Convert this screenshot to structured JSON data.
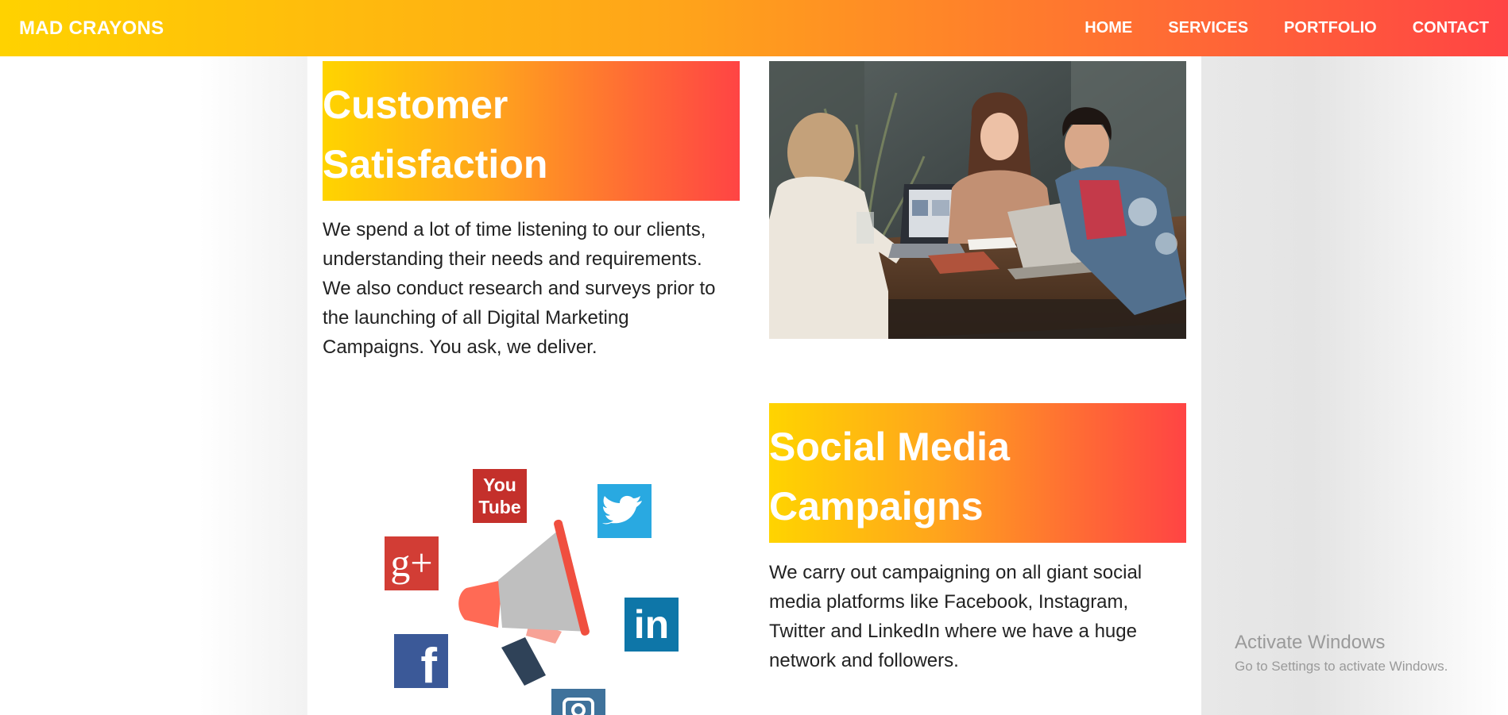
{
  "navbar": {
    "brand": "MAD CRAYONS",
    "links": [
      "HOME",
      "SERVICES",
      "PORTFOLIO",
      "CONTACT"
    ]
  },
  "sections": [
    {
      "heading_line1": "Customer",
      "heading_line2": "Satisfaction",
      "body_lines": [
        "We spend a lot of time listening to our clients,",
        "understanding their needs and requirements.",
        "We also conduct research and surveys prior to",
        "the launching of all Digital Marketing",
        "Campaigns. You ask, we deliver."
      ]
    },
    {
      "heading_line1": "Social Media",
      "heading_line2": "Campaigns",
      "body_lines": [
        "We carry out campaigning on all giant social",
        "media platforms like Facebook, Instagram,",
        "Twitter and LinkedIn where we have a huge",
        "network and followers."
      ]
    }
  ],
  "illustration": {
    "youtube_line1": "You",
    "youtube_line2": "Tube",
    "google_plus": "g+",
    "linkedin": "in",
    "facebook": "f"
  },
  "watermark": {
    "title": "Activate Windows",
    "subtitle": "Go to Settings to activate Windows."
  },
  "colors": {
    "gradient_start": "#ffd200",
    "gradient_end": "#ff4444",
    "youtube": "#c4302b",
    "twitter": "#29a9e1",
    "google": "#d23d35",
    "linkedin": "#0e76a8",
    "facebook": "#3b5998",
    "instagram": "#3f729b"
  }
}
